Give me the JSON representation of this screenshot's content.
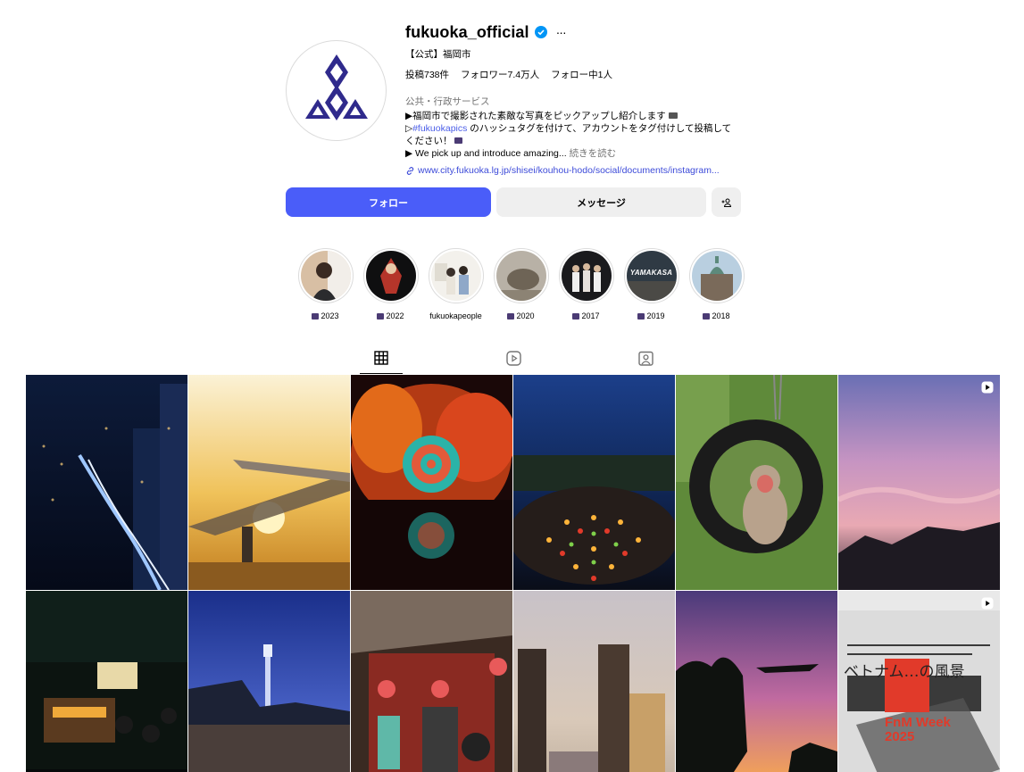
{
  "profile": {
    "username": "fukuoka_official",
    "fullname": "【公式】福岡市",
    "stats": {
      "posts": "投稿738件",
      "followers": "フォロワー7.4万人",
      "following": "フォロー中1人"
    },
    "category": "公共・行政サービス",
    "bio_line1": "▶福岡市で撮影された素敵な写真をピックアップし紹介します",
    "bio_line2_prefix": "▷",
    "bio_hashtag": "#fukuokapics",
    "bio_line2_suffix": " のハッシュタグを付けて、アカウントをタグ付けして投稿して",
    "bio_line3": "ください！",
    "bio_line4": "▶ We pick up and introduce amazing...",
    "bio_more": "続きを読む",
    "link": "www.city.fukuoka.lg.jp/shisei/kouhou-hodo/social/documents/instagram..."
  },
  "buttons": {
    "follow": "フォロー",
    "message": "メッセージ"
  },
  "highlights": [
    {
      "label": "2023",
      "camera": true
    },
    {
      "label": "2022",
      "camera": true
    },
    {
      "label": "fukuokapeople",
      "camera": false
    },
    {
      "label": "2020",
      "camera": true
    },
    {
      "label": "2017",
      "camera": true
    },
    {
      "label": "2019",
      "camera": true
    },
    {
      "label": "2018",
      "camera": true
    }
  ],
  "highlight_texts": {
    "yamakasa": "YAMAKASA"
  },
  "tabs": [
    "grid-icon",
    "reels-icon",
    "tagged-icon"
  ],
  "posts": {
    "post12_text": "FnM Week 2025",
    "post12_title": "ベトナム…の風景"
  },
  "colors": {
    "accent": "#4a5df9",
    "link": "#3d4bd9",
    "hashtag": "#4b5ee8",
    "logo": "#2f2a8c"
  }
}
